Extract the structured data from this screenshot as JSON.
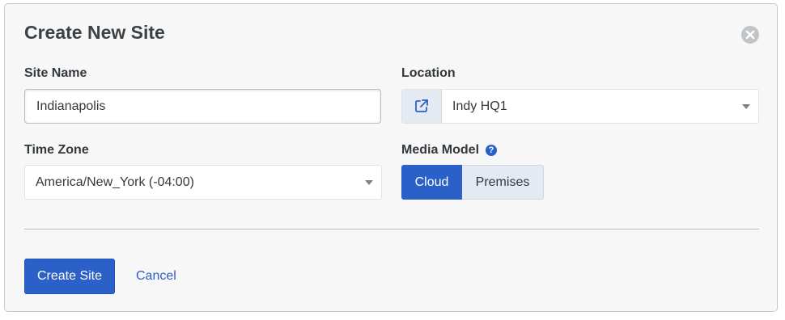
{
  "dialog": {
    "title": "Create New Site"
  },
  "site_name": {
    "label": "Site Name",
    "value": "Indianapolis",
    "placeholder": ""
  },
  "location": {
    "label": "Location",
    "value": "Indy HQ1",
    "link_icon": "external-link-icon"
  },
  "time_zone": {
    "label": "Time Zone",
    "value": "America/New_York (-04:00)"
  },
  "media_model": {
    "label": "Media Model",
    "help_icon": "question-circle-icon",
    "help_glyph": "?",
    "options": [
      "Cloud",
      "Premises"
    ],
    "selected": "Cloud"
  },
  "footer": {
    "create_label": "Create Site",
    "cancel_label": "Cancel"
  },
  "colors": {
    "accent": "#2a60c8",
    "background": "#f7f7f7",
    "close_icon": "#c2c5c8"
  }
}
